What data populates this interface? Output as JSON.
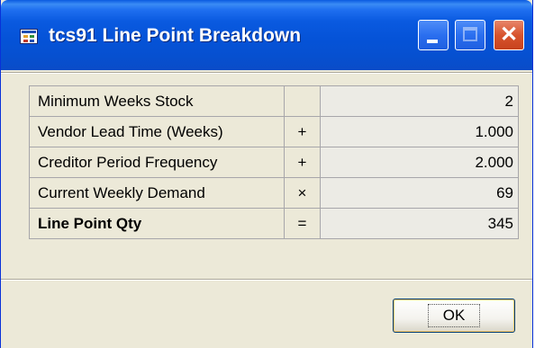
{
  "window": {
    "title": "tcs91 Line Point Breakdown",
    "app_icon": "table-window-icon",
    "controls": {
      "minimize_icon": "minimize-icon",
      "maximize_icon": "maximize-icon",
      "close_icon": "close-icon",
      "close_glyph": "✕"
    }
  },
  "breakdown": {
    "rows": [
      {
        "label": "Minimum Weeks Stock",
        "operator": "",
        "value": "2"
      },
      {
        "label": "Vendor Lead Time (Weeks)",
        "operator": "+",
        "value": "1.000"
      },
      {
        "label": "Creditor Period Frequency",
        "operator": "+",
        "value": "2.000"
      },
      {
        "label": "Current Weekly Demand",
        "operator": "×",
        "value": "69"
      },
      {
        "label": "Line Point Qty",
        "operator": "=",
        "value": "345"
      }
    ]
  },
  "footer": {
    "ok_label": "OK"
  },
  "colors": {
    "titlebar": "#0a5ae0",
    "dialog_bg": "#ece9d8",
    "value_cell_bg": "#ecebe5",
    "close_button": "#d8542e"
  }
}
